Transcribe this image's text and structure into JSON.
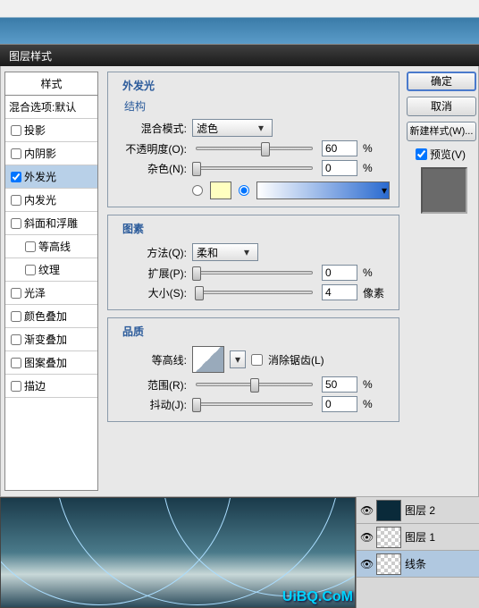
{
  "dialog_title": "图层样式",
  "styles": {
    "header": "样式",
    "blend_options": "混合选项:默认",
    "items": [
      {
        "label": "投影",
        "checked": false
      },
      {
        "label": "内阴影",
        "checked": false
      },
      {
        "label": "外发光",
        "checked": true,
        "selected": true
      },
      {
        "label": "内发光",
        "checked": false
      },
      {
        "label": "斜面和浮雕",
        "checked": false
      },
      {
        "label": "等高线",
        "checked": false,
        "indent": true
      },
      {
        "label": "纹理",
        "checked": false,
        "indent": true
      },
      {
        "label": "光泽",
        "checked": false
      },
      {
        "label": "颜色叠加",
        "checked": false
      },
      {
        "label": "渐变叠加",
        "checked": false
      },
      {
        "label": "图案叠加",
        "checked": false
      },
      {
        "label": "描边",
        "checked": false
      }
    ]
  },
  "outer_glow": {
    "title": "外发光",
    "structure": {
      "title": "结构",
      "blend_mode_label": "混合模式:",
      "blend_mode_value": "滤色",
      "opacity_label": "不透明度(O):",
      "opacity_value": "60",
      "opacity_unit": "%",
      "noise_label": "杂色(N):",
      "noise_value": "0",
      "noise_unit": "%",
      "solid_color": "#FFFFC0",
      "gradient_selected": true
    },
    "elements": {
      "title": "图素",
      "technique_label": "方法(Q):",
      "technique_value": "柔和",
      "spread_label": "扩展(P):",
      "spread_value": "0",
      "spread_unit": "%",
      "size_label": "大小(S):",
      "size_value": "4",
      "size_unit": "像素"
    },
    "quality": {
      "title": "品质",
      "contour_label": "等高线:",
      "antialias_label": "消除锯齿(L)",
      "antialias_checked": false,
      "range_label": "范围(R):",
      "range_value": "50",
      "range_unit": "%",
      "jitter_label": "抖动(J):",
      "jitter_value": "0",
      "jitter_unit": "%"
    }
  },
  "buttons": {
    "ok": "确定",
    "cancel": "取消",
    "new_style": "新建样式(W)...",
    "preview": "预览(V)"
  },
  "layers": [
    {
      "name": "图层 2",
      "visible": true,
      "thumb": "dark"
    },
    {
      "name": "图层 1",
      "visible": true,
      "thumb": "checker"
    },
    {
      "name": "线条",
      "visible": true,
      "thumb": "checker",
      "selected": true
    }
  ],
  "watermark": "UiBQ.CoM"
}
